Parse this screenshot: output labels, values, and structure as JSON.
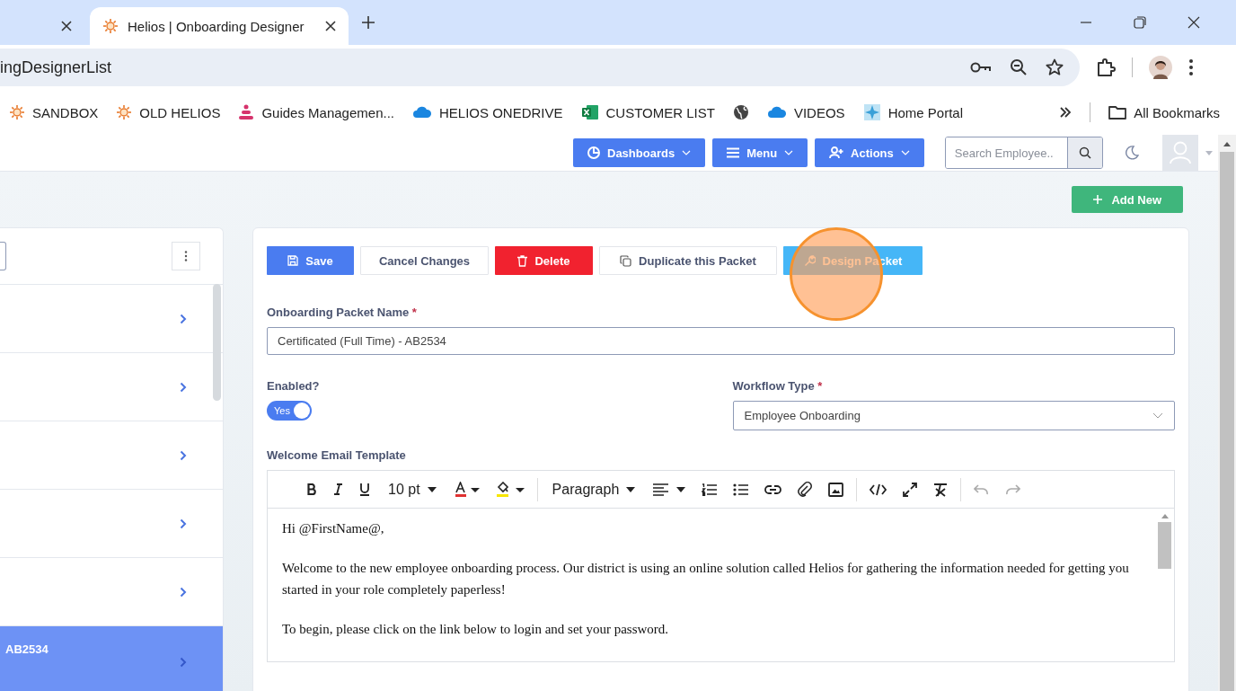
{
  "browser": {
    "tabs": [
      {
        "selected": false
      },
      {
        "title": "Helios | Onboarding Designer",
        "selected": true
      }
    ],
    "address": "ingDesignerList",
    "bookmarks": [
      {
        "kind": "sun",
        "label": "SANDBOX"
      },
      {
        "kind": "sun",
        "label": "OLD HELIOS"
      },
      {
        "kind": "dots",
        "label": "Guides Managemen..."
      },
      {
        "kind": "cloud",
        "label": "HELIOS ONEDRIVE"
      },
      {
        "kind": "sheet",
        "label": "CUSTOMER LIST"
      },
      {
        "kind": "globe"
      },
      {
        "kind": "cloud",
        "label": "VIDEOS"
      },
      {
        "kind": "portal",
        "label": "Home Portal"
      }
    ],
    "all_bookmarks": "All Bookmarks"
  },
  "header": {
    "nav": [
      {
        "kind": "chart",
        "label": "Dashboards"
      },
      {
        "kind": "bars",
        "label": "Menu"
      },
      {
        "kind": "user",
        "label": "Actions"
      }
    ],
    "search": {
      "placeholder": "Search Employee.."
    }
  },
  "add_new": "Add New",
  "list": {
    "rows": [
      {
        "selected": false
      },
      {
        "selected": false
      },
      {
        "selected": false
      },
      {
        "selected": false
      },
      {
        "selected": false
      },
      {
        "label": "AB2534",
        "selected": true
      }
    ]
  },
  "actions": [
    {
      "kind": "primary",
      "label": "Save"
    },
    {
      "kind": "plain",
      "label": "Cancel Changes"
    },
    {
      "kind": "danger",
      "label": "Delete"
    },
    {
      "kind": "outline",
      "label": "Duplicate this Packet"
    },
    {
      "kind": "info",
      "label": "Design Packet"
    }
  ],
  "form": {
    "name_label": "Onboarding Packet Name",
    "name_required_mark": "*",
    "name_value": "Certificated (Full Time) - AB2534",
    "enabled_label": "Enabled?",
    "enabled": {
      "on": true,
      "label": "Yes"
    },
    "workflow_label": "Workflow Type",
    "workflow_required_mark": "*",
    "workflow_value": "Employee Onboarding",
    "email_label": "Welcome Email Template"
  },
  "editor": {
    "font_size": "10 pt",
    "block": "Paragraph",
    "paragraphs": [
      "Hi @FirstName@,",
      "Welcome to the new employee onboarding process. Our district is using an online solution called Helios for gathering the information needed for getting you started in your role completely paperless!",
      "To begin, please click on the link below to login and set your password."
    ]
  }
}
